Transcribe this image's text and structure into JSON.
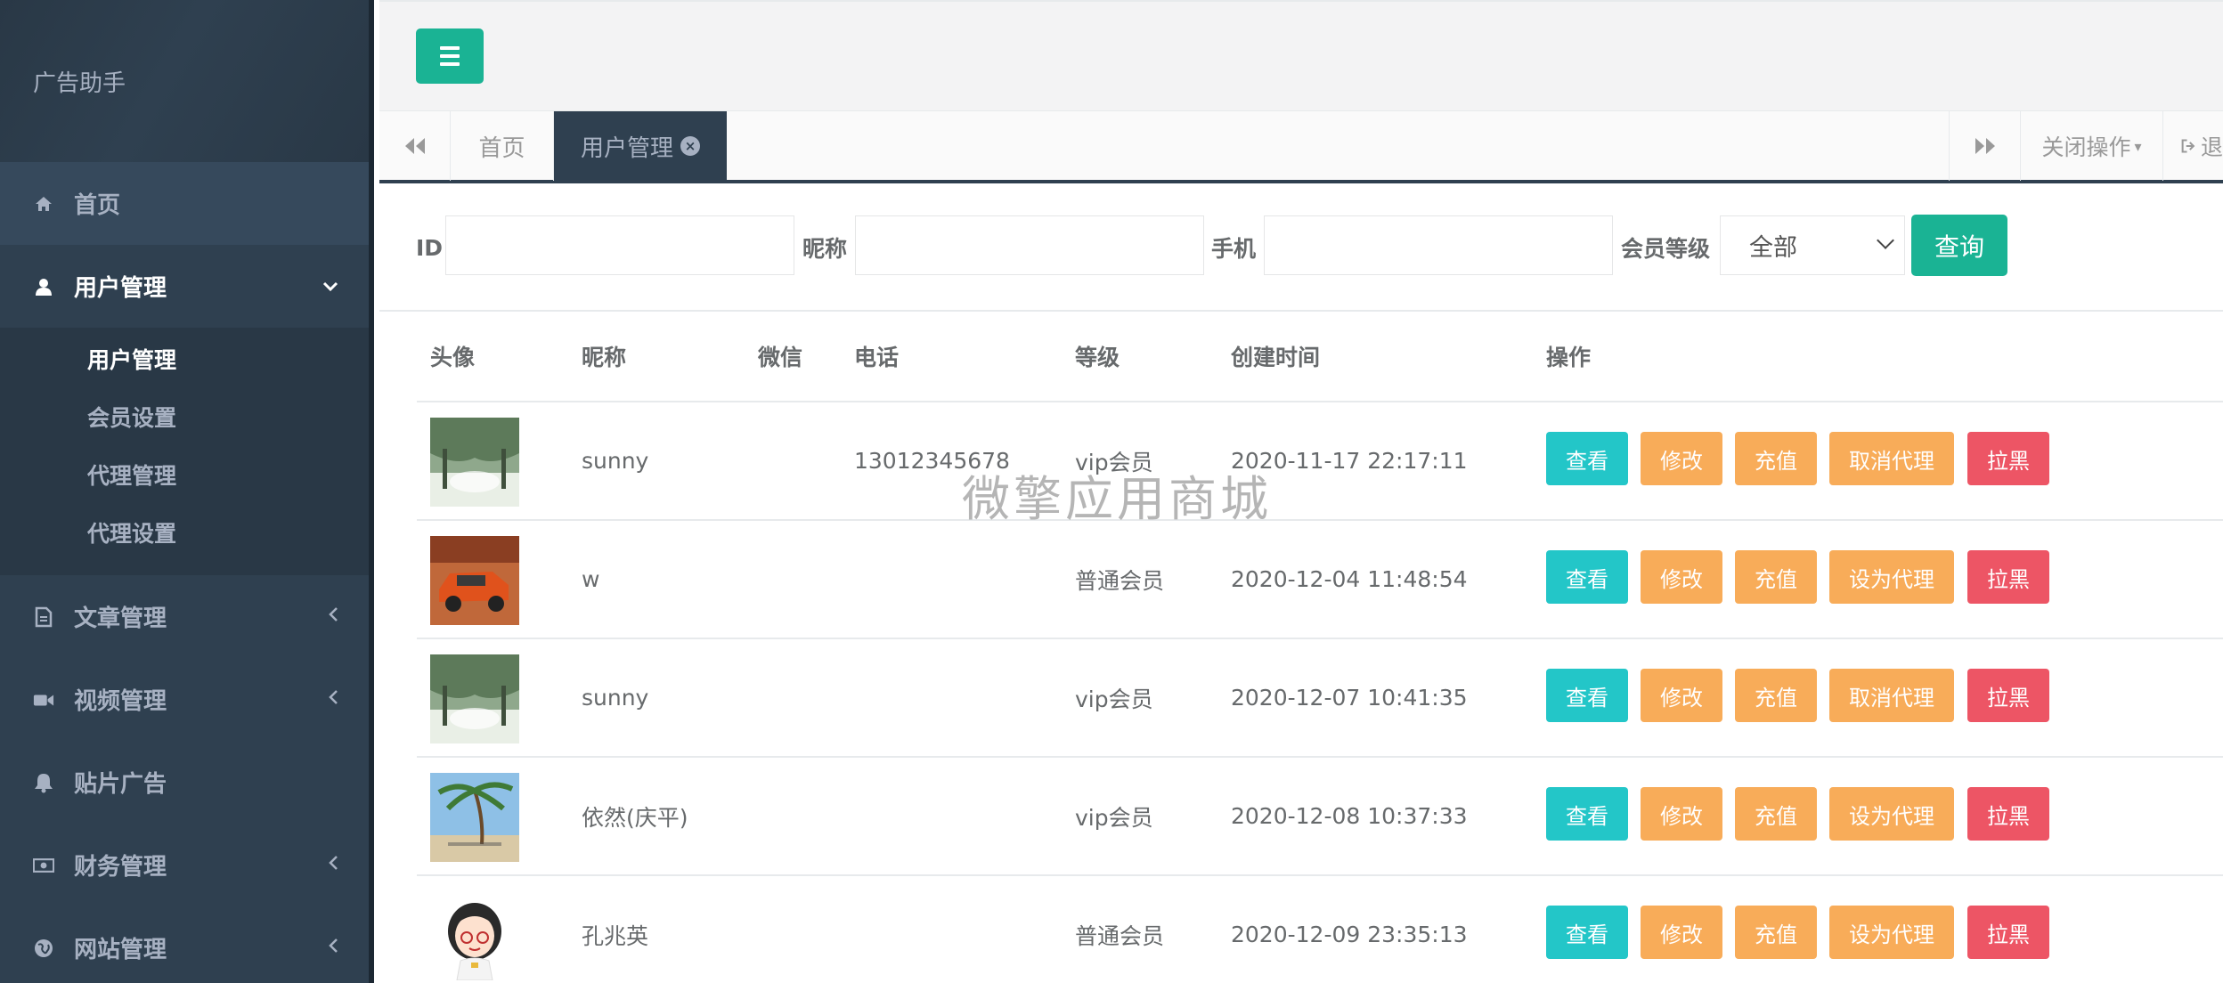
{
  "sidebar": {
    "brand": "广告助手",
    "items": [
      {
        "label": "首页",
        "icon": "home-icon"
      },
      {
        "label": "用户管理",
        "icon": "user-icon",
        "expanded": true,
        "children": [
          "用户管理",
          "会员设置",
          "代理管理",
          "代理设置"
        ]
      },
      {
        "label": "文章管理",
        "icon": "file-icon"
      },
      {
        "label": "视频管理",
        "icon": "video-camera-icon"
      },
      {
        "label": "贴片广告",
        "icon": "bell-icon"
      },
      {
        "label": "财务管理",
        "icon": "money-icon"
      },
      {
        "label": "网站管理",
        "icon": "globe-icon"
      }
    ]
  },
  "tabs": {
    "items": [
      "首页",
      "用户管理"
    ],
    "close_ops": "关闭操作",
    "exit": "退"
  },
  "filter": {
    "id_label": "ID",
    "nickname_label": "昵称",
    "phone_label": "手机",
    "level_label": "会员等级",
    "level_value": "全部",
    "query_label": "查询"
  },
  "table": {
    "headers": [
      "头像",
      "昵称",
      "微信",
      "电话",
      "等级",
      "创建时间",
      "操作"
    ],
    "actions": {
      "view": "查看",
      "edit": "修改",
      "charge": "充值",
      "block": "拉黑"
    },
    "rows": [
      {
        "nickname": "sunny",
        "wechat": "",
        "phone": "13012345678",
        "level": "vip会员",
        "created": "2020-11-17 22:17:11",
        "agent_action": "取消代理",
        "avatar": "forest"
      },
      {
        "nickname": "w",
        "wechat": "",
        "phone": "",
        "level": "普通会员",
        "created": "2020-12-04 11:48:54",
        "agent_action": "设为代理",
        "avatar": "car"
      },
      {
        "nickname": "sunny",
        "wechat": "",
        "phone": "",
        "level": "vip会员",
        "created": "2020-12-07 10:41:35",
        "agent_action": "取消代理",
        "avatar": "forest"
      },
      {
        "nickname": "依然(庆平)",
        "wechat": "",
        "phone": "",
        "level": "vip会员",
        "created": "2020-12-08 10:37:33",
        "agent_action": "设为代理",
        "avatar": "beach"
      },
      {
        "nickname": "孔兆英",
        "wechat": "",
        "phone": "",
        "level": "普通会员",
        "created": "2020-12-09 23:35:13",
        "agent_action": "设为代理",
        "avatar": "cartoon-girl"
      }
    ]
  },
  "watermark": "微擎应用商城",
  "colors": {
    "primary": "#1ab394",
    "info": "#23c6c8",
    "warning": "#f8ac59",
    "danger": "#ed5565",
    "sidebar": "#2f4050"
  }
}
